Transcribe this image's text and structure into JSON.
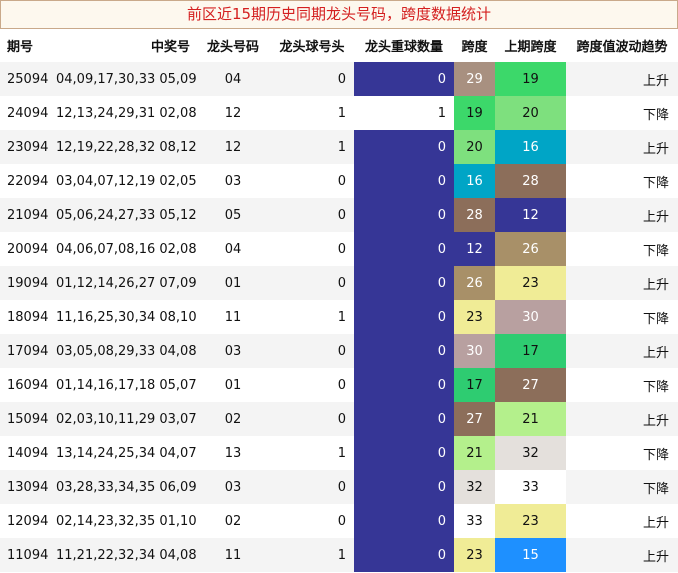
{
  "title": "前区近15期历史同期龙头号码，跨度数据统计",
  "headers": [
    "期号",
    "中奖号",
    "龙头号码",
    "龙头球号头",
    "龙头重球数量",
    "跨度",
    "上期跨度",
    "跨度值波动趋势"
  ],
  "colors": {
    "repeat_blue": "#363696",
    "span_colors": {
      "12": "#363696",
      "15": "#1e90ff",
      "16": "#00a5c6",
      "17": "#2ecc71",
      "19": "#3cd86a",
      "20": "#7ee07e",
      "21": "#b4f08c",
      "23": "#f0ec96",
      "26": "#a89068",
      "27": "#8c6e5a",
      "28": "#8c6e5a",
      "29": "#a89080",
      "30": "#b8a0a0",
      "32": "#e4e0dc",
      "33": "#ffffff"
    }
  },
  "rows": [
    {
      "issue": "25094",
      "numbers": "04,09,17,30,33 05,09",
      "head": "04",
      "head_ten": "0",
      "repeat": "0",
      "span": "29",
      "prev_span": "19",
      "trend": "上升"
    },
    {
      "issue": "24094",
      "numbers": "12,13,24,29,31 02,08",
      "head": "12",
      "head_ten": "1",
      "repeat": "1",
      "span": "19",
      "prev_span": "20",
      "trend": "下降"
    },
    {
      "issue": "23094",
      "numbers": "12,19,22,28,32 08,12",
      "head": "12",
      "head_ten": "1",
      "repeat": "0",
      "span": "20",
      "prev_span": "16",
      "trend": "上升"
    },
    {
      "issue": "22094",
      "numbers": "03,04,07,12,19 02,05",
      "head": "03",
      "head_ten": "0",
      "repeat": "0",
      "span": "16",
      "prev_span": "28",
      "trend": "下降"
    },
    {
      "issue": "21094",
      "numbers": "05,06,24,27,33 05,12",
      "head": "05",
      "head_ten": "0",
      "repeat": "0",
      "span": "28",
      "prev_span": "12",
      "trend": "上升"
    },
    {
      "issue": "20094",
      "numbers": "04,06,07,08,16 02,08",
      "head": "04",
      "head_ten": "0",
      "repeat": "0",
      "span": "12",
      "prev_span": "26",
      "trend": "下降"
    },
    {
      "issue": "19094",
      "numbers": "01,12,14,26,27 07,09",
      "head": "01",
      "head_ten": "0",
      "repeat": "0",
      "span": "26",
      "prev_span": "23",
      "trend": "上升"
    },
    {
      "issue": "18094",
      "numbers": "11,16,25,30,34 08,10",
      "head": "11",
      "head_ten": "1",
      "repeat": "0",
      "span": "23",
      "prev_span": "30",
      "trend": "下降"
    },
    {
      "issue": "17094",
      "numbers": "03,05,08,29,33 04,08",
      "head": "03",
      "head_ten": "0",
      "repeat": "0",
      "span": "30",
      "prev_span": "17",
      "trend": "上升"
    },
    {
      "issue": "16094",
      "numbers": "01,14,16,17,18 05,07",
      "head": "01",
      "head_ten": "0",
      "repeat": "0",
      "span": "17",
      "prev_span": "27",
      "trend": "下降"
    },
    {
      "issue": "15094",
      "numbers": "02,03,10,11,29 03,07",
      "head": "02",
      "head_ten": "0",
      "repeat": "0",
      "span": "27",
      "prev_span": "21",
      "trend": "上升"
    },
    {
      "issue": "14094",
      "numbers": "13,14,24,25,34 04,07",
      "head": "13",
      "head_ten": "1",
      "repeat": "0",
      "span": "21",
      "prev_span": "32",
      "trend": "下降"
    },
    {
      "issue": "13094",
      "numbers": "03,28,33,34,35 06,09",
      "head": "03",
      "head_ten": "0",
      "repeat": "0",
      "span": "32",
      "prev_span": "33",
      "trend": "下降"
    },
    {
      "issue": "12094",
      "numbers": "02,14,23,32,35 01,10",
      "head": "02",
      "head_ten": "0",
      "repeat": "0",
      "span": "33",
      "prev_span": "23",
      "trend": "上升"
    },
    {
      "issue": "11094",
      "numbers": "11,21,22,32,34 04,08",
      "head": "11",
      "head_ten": "1",
      "repeat": "0",
      "span": "23",
      "prev_span": "15",
      "trend": "上升"
    }
  ]
}
